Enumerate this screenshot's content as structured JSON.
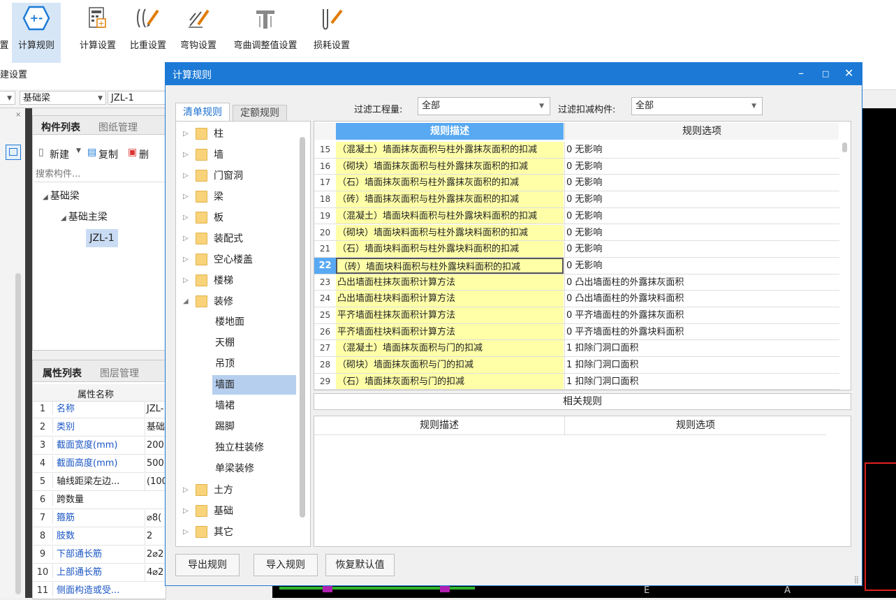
{
  "ribbon": {
    "buttons": [
      {
        "label": "置",
        "icon": "settings-icon"
      },
      {
        "label": "计算规则",
        "icon": "calc-rule-icon"
      },
      {
        "label": "计算设置",
        "icon": "calc-setting-icon"
      },
      {
        "label": "比重设置",
        "icon": "weight-setting-icon"
      },
      {
        "label": "弯钩设置",
        "icon": "hook-setting-icon"
      },
      {
        "label": "弯曲调整值设置",
        "icon": "bend-adjust-icon"
      },
      {
        "label": "损耗设置",
        "icon": "loss-setting-icon"
      }
    ],
    "group_label": "建设置"
  },
  "combobar": {
    "category": "基础梁",
    "component": "JZL-1"
  },
  "component_panel": {
    "tabs": [
      "构件列表",
      "图纸管理"
    ],
    "toolbar": {
      "new": "新建",
      "copy": "复制",
      "delete": "删"
    },
    "search_placeholder": "搜索构件...",
    "tree": {
      "root": "基础梁",
      "child": "基础主梁",
      "leaf": "JZL-1"
    }
  },
  "property_panel": {
    "tabs": [
      "属性列表",
      "图层管理"
    ],
    "header": "属性名称",
    "rows": [
      {
        "n": "1",
        "name": "名称",
        "value": "JZL-",
        "blue": true
      },
      {
        "n": "2",
        "name": "类别",
        "value": "基础",
        "blue": true
      },
      {
        "n": "3",
        "name": "截面宽度(mm)",
        "value": "200",
        "blue": true
      },
      {
        "n": "4",
        "name": "截面高度(mm)",
        "value": "500",
        "blue": true
      },
      {
        "n": "5",
        "name": "轴线距梁左边...",
        "value": "(100",
        "blue": false
      },
      {
        "n": "6",
        "name": "跨数量",
        "value": "",
        "blue": false
      },
      {
        "n": "7",
        "name": "箍筋",
        "value": "⌀8(",
        "blue": true
      },
      {
        "n": "8",
        "name": "肢数",
        "value": "2",
        "blue": true
      },
      {
        "n": "9",
        "name": "下部通长筋",
        "value": "2⌀2",
        "blue": true
      },
      {
        "n": "10",
        "name": "上部通长筋",
        "value": "4⌀2",
        "blue": true
      },
      {
        "n": "11",
        "name": "侧面构造或受...",
        "value": "",
        "blue": true
      }
    ]
  },
  "dialog": {
    "title": "计算规则",
    "tabs": [
      "清单规则",
      "定额规则"
    ],
    "filter_qty_label": "过滤工程量:",
    "filter_qty_value": "全部",
    "filter_deduct_label": "过滤扣减构件:",
    "filter_deduct_value": "全部",
    "tree": {
      "folders": [
        "柱",
        "墙",
        "门窗洞",
        "梁",
        "板",
        "装配式",
        "空心楼盖",
        "楼梯",
        "装修"
      ],
      "leaves": [
        "楼地面",
        "天棚",
        "吊顶",
        "墙面",
        "墙裙",
        "踢脚",
        "独立柱装修",
        "单梁装修"
      ],
      "folders_after": [
        "土方",
        "基础",
        "其它"
      ]
    },
    "grid": {
      "header_desc": "规则描述",
      "header_option": "规则选项",
      "rows": [
        {
          "n": "15",
          "desc": "（混凝土）墙面抹灰面积与柱外露抹灰面积的扣减",
          "opt": "0  无影响",
          "y": true
        },
        {
          "n": "16",
          "desc": "（砌块）墙面抹灰面积与柱外露抹灰面积的扣减",
          "opt": "0  无影响",
          "y": true
        },
        {
          "n": "17",
          "desc": "（石）墙面抹灰面积与柱外露抹灰面积的扣减",
          "opt": "0  无影响",
          "y": true
        },
        {
          "n": "18",
          "desc": "（砖）墙面抹灰面积与柱外露抹灰面积的扣减",
          "opt": "0  无影响",
          "y": true
        },
        {
          "n": "19",
          "desc": "（混凝土）墙面块料面积与柱外露块料面积的扣减",
          "opt": "0  无影响",
          "y": true
        },
        {
          "n": "20",
          "desc": "（砌块）墙面块料面积与柱外露块料面积的扣减",
          "opt": "0  无影响",
          "y": true
        },
        {
          "n": "21",
          "desc": "（石）墙面块料面积与柱外露块料面积的扣减",
          "opt": "0  无影响",
          "y": true
        },
        {
          "n": "22",
          "desc": "（砖）墙面块料面积与柱外露块料面积的扣减",
          "opt": "0  无影响",
          "y": true,
          "cur": true
        },
        {
          "n": "23",
          "desc": "凸出墙面柱抹灰面积计算方法",
          "opt": "0 凸出墙面柱的外露抹灰面积",
          "y": true
        },
        {
          "n": "24",
          "desc": "凸出墙面柱块料面积计算方法",
          "opt": "0 凸出墙面柱的外露块料面积",
          "y": true
        },
        {
          "n": "25",
          "desc": "平齐墙面柱抹灰面积计算方法",
          "opt": "0 平齐墙面柱的外露抹灰面积",
          "y": true
        },
        {
          "n": "26",
          "desc": "平齐墙面柱块料面积计算方法",
          "opt": "0 平齐墙面柱的外露块料面积",
          "y": true
        },
        {
          "n": "27",
          "desc": "（混凝土）墙面抹灰面积与门的扣减",
          "opt": "1  扣除门洞口面积",
          "y": true
        },
        {
          "n": "28",
          "desc": "（砌块）墙面抹灰面积与门的扣减",
          "opt": "1  扣除门洞口面积",
          "y": true
        },
        {
          "n": "29",
          "desc": "（石）墙面抹灰面积与门的扣减",
          "opt": "1  扣除门洞口面积",
          "y": true
        }
      ]
    },
    "related_title": "相关规则",
    "related_header_desc": "规则描述",
    "related_header_option": "规则选项",
    "buttons": {
      "export": "导出规则",
      "import": "导入规则",
      "restore": "恢复默认值"
    }
  },
  "canvas_labels": {
    "a": "A",
    "e": "E"
  }
}
